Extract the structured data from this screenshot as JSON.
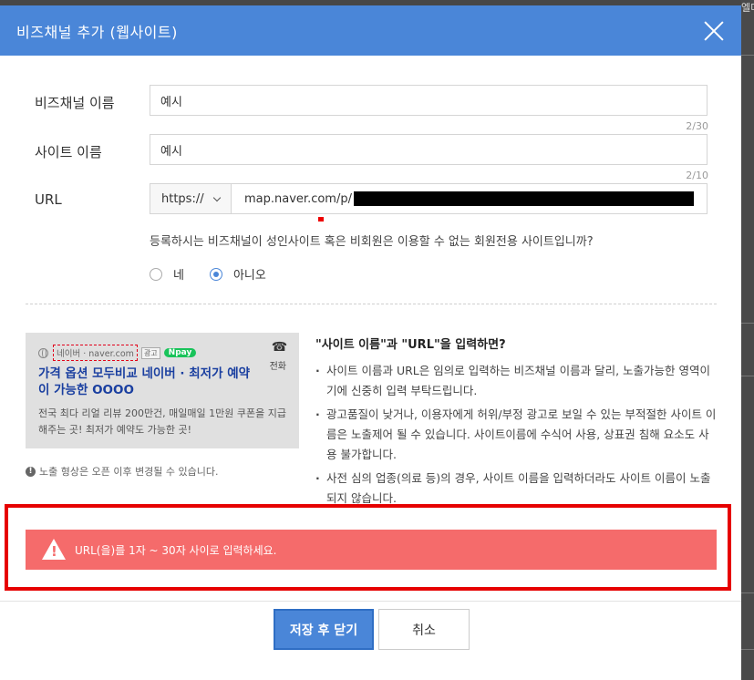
{
  "background": {
    "right_label": "엘미"
  },
  "modal": {
    "title": "비즈채널 추가 (웹사이트)",
    "close_icon": "close-icon"
  },
  "form": {
    "bizchannel_name": {
      "label": "비즈채널 이름",
      "value": "예시",
      "counter": "2/30"
    },
    "site_name": {
      "label": "사이트 이름",
      "value": "예시",
      "counter": "2/10"
    },
    "url": {
      "label": "URL",
      "protocol": "https://",
      "value": "map.naver.com/p/"
    },
    "adult_question": "등록하시는 비즈채널이 성인사이트 혹은 비회원은 이용할 수 없는 회원전용 사이트입니까?",
    "radio": {
      "yes": "네",
      "no": "아니오",
      "selected": "no"
    }
  },
  "preview": {
    "site": "네이버 · naver.com",
    "ad_tag": "광고",
    "pay": "pay",
    "phone": "전화",
    "title": "가격 옵션 모두비교 네이버 · 최저가 예약이 가능한 OOOO",
    "desc": "전국 최다 리얼 리뷰 200만건, 매일매일 1만원 쿠폰을 지급해주는 곳! 최저가 예약도 가능한 곳!",
    "note": "노출 형상은 오픈 이후 변경될 수 있습니다."
  },
  "guide": {
    "title": "\"사이트 이름\"과 \"URL\"을 입력하면?",
    "items": [
      "사이트 이름과 URL은 임의로 입력하는 비즈채널 이름과 달리, 노출가능한 영역이기에 신중히 입력 부탁드립니다.",
      "광고품질이 낮거나, 이용자에게 허위/부정 광고로 보일 수 있는 부적절한 사이트 이름은 노출제어 될 수 있습니다. 사이트이름에 수식어 사용, 상표권 침해 요소도 사용 불가합니다.",
      "사전 심의 업종(의료 등)의 경우, 사이트 이름을 입력하더라도 사이트 이름이 노출되지 않습니다."
    ]
  },
  "error": {
    "message": "URL(을)를 1자 ~ 30자 사이로 입력하세요."
  },
  "buttons": {
    "save_close": "저장 후 닫기",
    "cancel": "취소"
  },
  "colors": {
    "accent": "#4a86d8",
    "error": "#f56b6b",
    "error_frame": "#e60000"
  }
}
